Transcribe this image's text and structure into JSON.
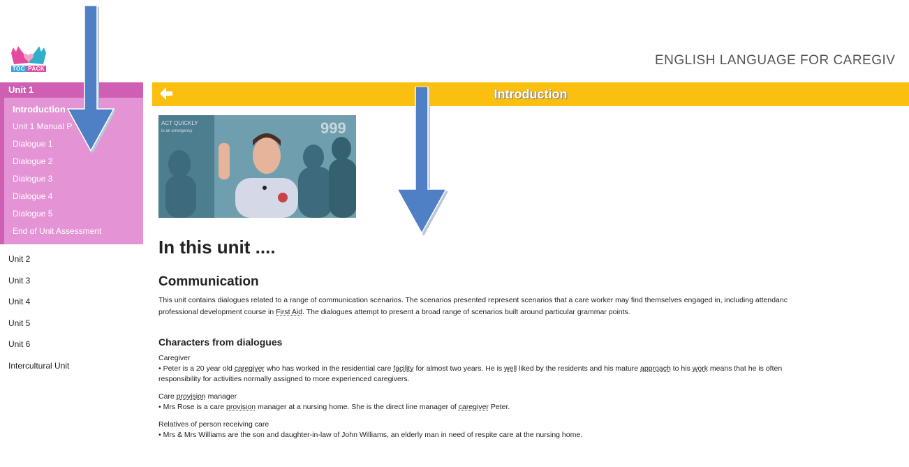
{
  "logo": {
    "seg1": "TOC",
    "seg2": "PACK"
  },
  "site_title": "ENGLISH LANGUAGE FOR CAREGIV",
  "sidebar": {
    "active_unit": "Unit 1",
    "submenu": [
      "Introduction",
      "Unit 1 Manual P",
      "Dialogue 1",
      "Dialogue 2",
      "Dialogue 3",
      "Dialogue 4",
      "Dialogue 5",
      "End of Unit Assessment"
    ],
    "units": [
      "Unit 2",
      "Unit 3",
      "Unit 4",
      "Unit 5",
      "Unit 6",
      "Intercultural Unit"
    ]
  },
  "banner": {
    "title": "Introduction"
  },
  "video": {
    "sign_text_1": "ACT QUICKLY",
    "sign_text_2": "in an emergency",
    "sign_number": "999"
  },
  "content": {
    "h1": "In this unit ....",
    "h2": "Communication",
    "intro_line1": "This unit contains dialogues related to a range of communication scenarios. The scenarios presented represent scenarios that a care worker may find themselves engaged in, including attendanc",
    "intro_line2_a": "professional development course in ",
    "intro_line2_link": "First Aid",
    "intro_line2_b": ". The dialogues attempt to present a broad range of scenarios built around particular grammar points.",
    "h3": "Characters from dialogues",
    "caregiver_title": "Caregiver",
    "caregiver_1": "• Peter is a 20 year old ",
    "caregiver_u1": "caregiver",
    "caregiver_2": " who has worked in the  residential care ",
    "caregiver_u2": "facility",
    "caregiver_3": " for almost two years. He is ",
    "caregiver_u3": "well",
    "caregiver_4": " liked by the residents and his mature ",
    "caregiver_u4": "approach",
    "caregiver_5": " to his ",
    "caregiver_u5": "work",
    "caregiver_6": " means that he is often",
    "caregiver_line2": "responsibility for activities normally assigned to more experienced caregivers.",
    "manager_title_a": "Care ",
    "manager_title_u": "provision",
    "manager_title_b": " manager",
    "manager_1": "• Mrs Rose is a care ",
    "manager_u1": "provision",
    "manager_2": " manager at a nursing home. She is the direct line manager of ",
    "manager_u2": "caregiver",
    "manager_3": " Peter.",
    "relatives_title": "Relatives of person receiving care",
    "relatives_1": "• Mrs & Mrs Williams are the son and daughter-in-law of John Williams, an elderly man in need of respite care at the nursing home."
  },
  "colors": {
    "sidebar_active": "#cf5fb3",
    "submenu_bg": "#e493d4",
    "banner": "#fbbf10",
    "arrow": "#4f7fc4"
  }
}
